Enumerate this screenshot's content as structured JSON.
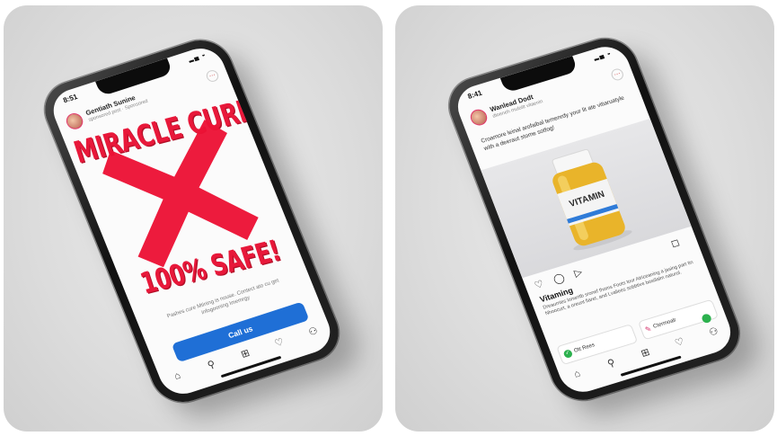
{
  "left_post": {
    "status_time": "8:51",
    "status_icons": "▂▄ ◒",
    "account_name": "Gentiath Sunine",
    "account_sub": "sponsored post · Sponsored",
    "headline_top": "MIRACLE CURE!",
    "headline_bottom": "100% SAFE!",
    "small_copy": "Pashes cure Mtining is nouse. Contect ato cu get infogooning Imemrgy",
    "call_button": "Call us",
    "nav_icons": [
      "⌂",
      "⚲",
      "⊞",
      "♡",
      "⚇"
    ]
  },
  "right_post": {
    "status_time": "8:41",
    "status_icons": "▂▄ ◒",
    "account_name": "Wanlead Dodt",
    "account_sub": "dtoeneh muloitt vitaenin",
    "caption": "Croamore leinal arofaibal temenrdy your lit ate vitiaruatyle with a deeraut stome sotfog!",
    "bottle_label": "VITAMIN",
    "action_icons": [
      "♡",
      "◯",
      "▷"
    ],
    "bookmark_icon": "◻",
    "product_name": "Vitaming",
    "description": "Dreaumies lonwritb sronef thoms Foots tour Atriceaning a jasing part tin Nhoocurt, a oreunt fiaret, and Lvaliees sobbtive bosiilalm naturol.",
    "cta_left": "Ott Rees",
    "cta_right": "Ctermoalr",
    "nav_icons": [
      "⌂",
      "⚲",
      "⊞",
      "♡",
      "⚇"
    ]
  }
}
